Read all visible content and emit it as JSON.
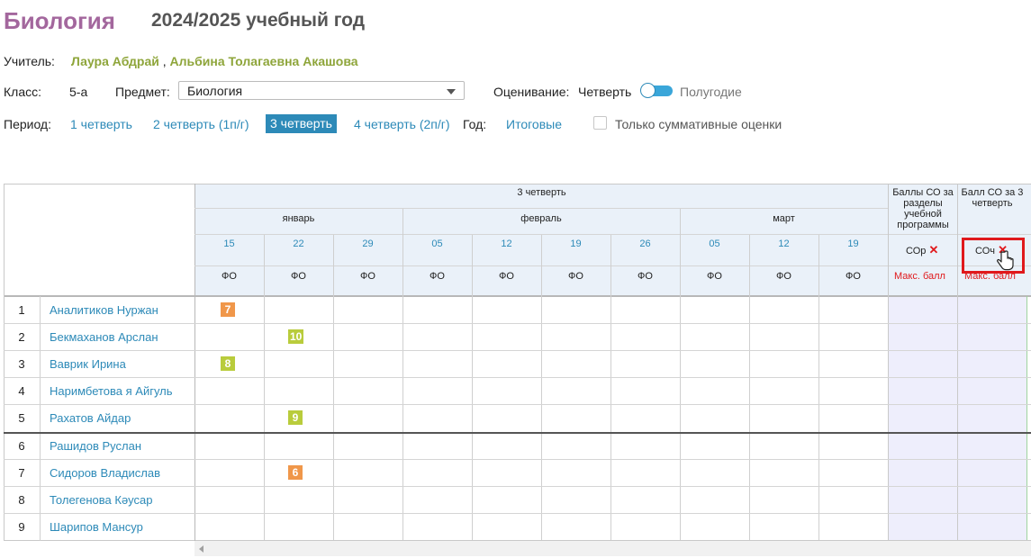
{
  "header": {
    "subject_title": "Биология",
    "school_year": "2024/2025 учебный год"
  },
  "teacher": {
    "label": "Учитель:",
    "names": [
      "Лаура Абдрай",
      "Альбина Толагаевна Акашова"
    ],
    "separator": ","
  },
  "filters": {
    "class_label": "Класс:",
    "class_value": "5-а",
    "subject_label": "Предмет:",
    "subject_value": "Биология",
    "grading_label": "Оценивание:",
    "grading_left": "Четверть",
    "grading_right": "Полугодие"
  },
  "periods": {
    "label": "Период:",
    "items": [
      "1 четверть",
      "2 четверть (1п/г)",
      "3 четверть",
      "4 четверть (2п/г)"
    ],
    "active": "3 четверть",
    "year_label": "Год:",
    "year_value": "Итоговые",
    "summative_only": "Только суммативные оценки",
    "summative_checked": false
  },
  "table": {
    "quarter": "3 четверть",
    "months": [
      "январь",
      "февраль",
      "март"
    ],
    "dates": [
      "15",
      "22",
      "29",
      "05",
      "12",
      "19",
      "26",
      "05",
      "12",
      "19"
    ],
    "assessment_type": "ФО",
    "sor_header": "Баллы СО за разделы учебной программы",
    "soch_header": "Балл СО за 3 четверть",
    "sor_label": "СОр",
    "soch_label": "СОч",
    "max_label": "Макс. балл",
    "students": [
      {
        "num": "1",
        "name": "Аналитиков Нуржан",
        "grades": [
          {
            "col": 0,
            "value": "7",
            "color": "#f0974a"
          }
        ]
      },
      {
        "num": "2",
        "name": "Бекмаханов Арслан",
        "grades": [
          {
            "col": 1,
            "value": "10",
            "color": "#b9cc3c"
          }
        ]
      },
      {
        "num": "3",
        "name": "Ваврик Ирина",
        "grades": [
          {
            "col": 0,
            "value": "8",
            "color": "#b9cc3c"
          }
        ]
      },
      {
        "num": "4",
        "name": "Наримбетова я Айгуль",
        "grades": []
      },
      {
        "num": "5",
        "name": "Рахатов Айдар",
        "grades": [
          {
            "col": 1,
            "value": "9",
            "color": "#b9cc3c"
          }
        ]
      },
      {
        "num": "6",
        "name": "Рашидов Руслан",
        "grades": []
      },
      {
        "num": "7",
        "name": "Сидоров Владислав",
        "grades": [
          {
            "col": 1,
            "value": "6",
            "color": "#f0974a"
          }
        ]
      },
      {
        "num": "8",
        "name": "Толегенова Кәусар",
        "grades": []
      },
      {
        "num": "9",
        "name": "Шарипов Мансур",
        "grades": []
      }
    ]
  },
  "colors": {
    "accent": "#2d8ab8",
    "title": "#a3679d",
    "teacher": "#8ea53a",
    "delete": "#e0191c",
    "highlight_border": "#e0191c"
  }
}
